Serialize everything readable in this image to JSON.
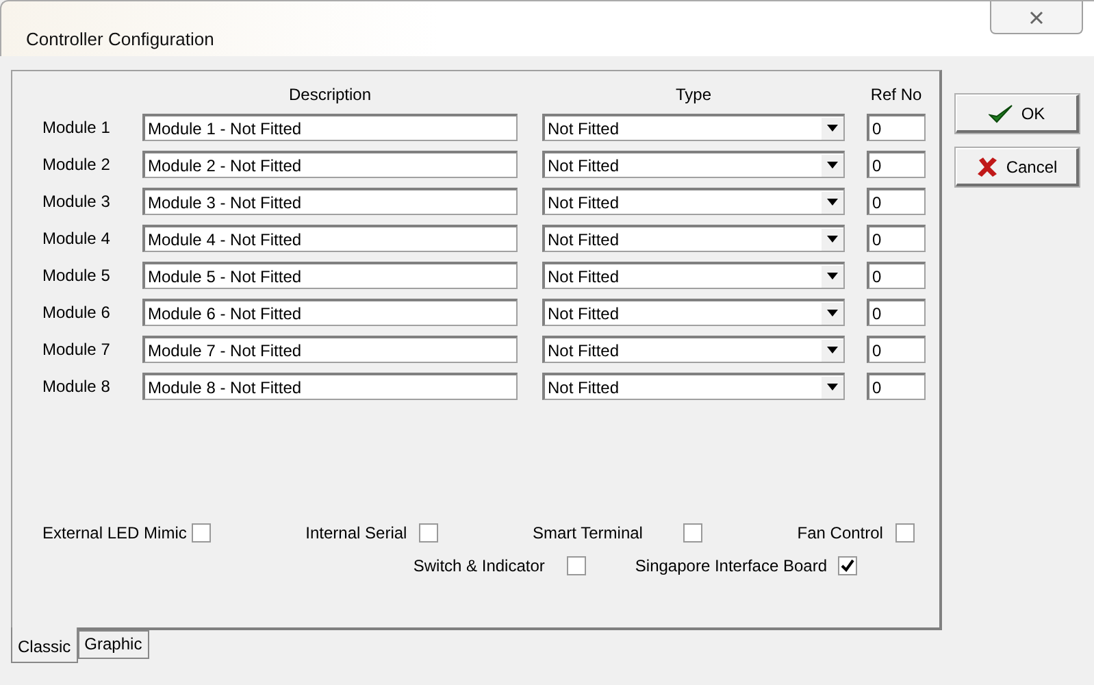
{
  "window": {
    "title": "Controller Configuration"
  },
  "columns": {
    "description": "Description",
    "type": "Type",
    "ref": "Ref No"
  },
  "modules": [
    {
      "label": "Module 1",
      "description": "Module 1 - Not Fitted",
      "type": "Not Fitted",
      "ref": "0"
    },
    {
      "label": "Module 2",
      "description": "Module 2 - Not Fitted",
      "type": "Not Fitted",
      "ref": "0"
    },
    {
      "label": "Module 3",
      "description": "Module 3 - Not Fitted",
      "type": "Not Fitted",
      "ref": "0"
    },
    {
      "label": "Module 4",
      "description": "Module 4 - Not Fitted",
      "type": "Not Fitted",
      "ref": "0"
    },
    {
      "label": "Module 5",
      "description": "Module 5 - Not Fitted",
      "type": "Not Fitted",
      "ref": "0"
    },
    {
      "label": "Module 6",
      "description": "Module 6 - Not Fitted",
      "type": "Not Fitted",
      "ref": "0"
    },
    {
      "label": "Module 7",
      "description": "Module 7 - Not Fitted",
      "type": "Not Fitted",
      "ref": "0"
    },
    {
      "label": "Module 8",
      "description": "Module 8 - Not Fitted",
      "type": "Not Fitted",
      "ref": "0"
    }
  ],
  "options_row_1": [
    {
      "label": "External LED Mimic",
      "checked": false
    },
    {
      "label": "Internal Serial",
      "checked": false
    },
    {
      "label": "Smart Terminal",
      "checked": false
    },
    {
      "label": "Fan Control",
      "checked": false
    }
  ],
  "options_row_2": [
    {
      "label": "Switch & Indicator",
      "checked": false
    },
    {
      "label": "Singapore Interface Board",
      "checked": true
    }
  ],
  "buttons": [
    {
      "label": "OK",
      "kind": "ok"
    },
    {
      "label": "Cancel",
      "kind": "cancel"
    }
  ],
  "tabs": [
    {
      "label": "Classic",
      "selected": true
    },
    {
      "label": "Graphic",
      "selected": false
    }
  ]
}
